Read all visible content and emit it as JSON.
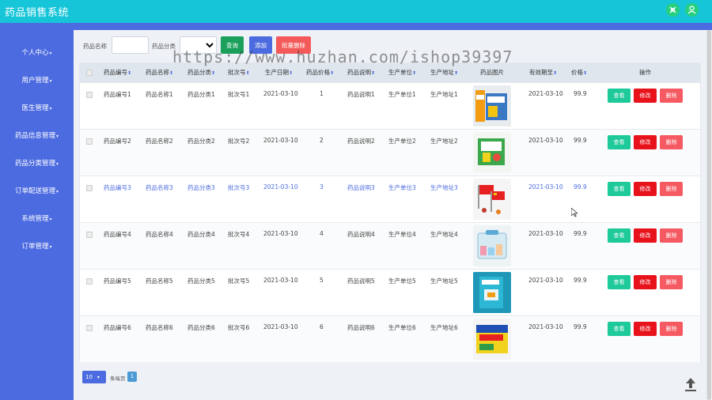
{
  "app": {
    "title": "药品销售系统",
    "colors": {
      "header": "#16c5d8",
      "sidebar": "#4c6be0",
      "search": "#1aa05b",
      "add": "#4c6be0",
      "batch_delete": "#f55a5a",
      "view": "#1ec99a",
      "edit": "#e8121b",
      "delete": "#f55a62"
    },
    "header_icons": [
      "expand-icon",
      "user-icon"
    ]
  },
  "sidebar": {
    "items": [
      {
        "label": "个人中心"
      },
      {
        "label": "用户管理"
      },
      {
        "label": "医生管理"
      },
      {
        "label": "药品信息管理"
      },
      {
        "label": "药品分类管理"
      },
      {
        "label": "订单配送管理"
      },
      {
        "label": "系统管理"
      },
      {
        "label": "订单管理"
      }
    ]
  },
  "filters": {
    "name_label": "药品名称",
    "name_value": "",
    "category_label": "药品分类",
    "category_value": "",
    "search_button": "查询",
    "add_button": "添加",
    "batch_delete_button": "批量删除"
  },
  "table": {
    "columns": [
      "药品编号",
      "药品名称",
      "药品分类",
      "批次号",
      "生产日期",
      "药品价格",
      "药品说明",
      "生产单位",
      "生产地址",
      "药品图片",
      "有效期至",
      "价格",
      "操作"
    ],
    "rows": [
      {
        "code": "药品编号1",
        "name": "药品名称1",
        "category": "药品分类1",
        "batch": "批次号1",
        "prod_date": "2021-03-10",
        "drug_price": "1",
        "desc": "药品说明1",
        "unit": "生产单位1",
        "address": "生产地址1",
        "image": "vitamin-box-image",
        "expiry": "2021-03-10",
        "price": "99.9"
      },
      {
        "code": "药品编号2",
        "name": "药品名称2",
        "category": "药品分类2",
        "batch": "批次号2",
        "prod_date": "2021-03-10",
        "drug_price": "2",
        "desc": "药品说明2",
        "unit": "生产单位2",
        "address": "生产地址2",
        "image": "green-medicine-box-image",
        "expiry": "2021-03-10",
        "price": "99.9"
      },
      {
        "code": "药品编号3",
        "name": "药品名称3",
        "category": "药品分类3",
        "batch": "批次号3",
        "prod_date": "2021-03-10",
        "drug_price": "3",
        "desc": "药品说明3",
        "unit": "生产单位3",
        "address": "生产地址3",
        "image": "pills-and-flags-image",
        "expiry": "2021-03-10",
        "price": "99.9"
      },
      {
        "code": "药品编号4",
        "name": "药品名称4",
        "category": "药品分类4",
        "batch": "批次号4",
        "prod_date": "2021-03-10",
        "drug_price": "4",
        "desc": "药品说明4",
        "unit": "生产单位4",
        "address": "生产地址4",
        "image": "first-aid-kit-image",
        "expiry": "2021-03-10",
        "price": "99.9"
      },
      {
        "code": "药品编号5",
        "name": "药品名称5",
        "category": "药品分类5",
        "batch": "批次号5",
        "prod_date": "2021-03-10",
        "drug_price": "5",
        "desc": "药品说明5",
        "unit": "生产单位5",
        "address": "生产地址5",
        "image": "teal-medicine-box-image",
        "expiry": "2021-03-10",
        "price": "99.9"
      },
      {
        "code": "药品编号6",
        "name": "药品名称6",
        "category": "药品分类6",
        "batch": "批次号6",
        "prod_date": "2021-03-10",
        "drug_price": "6",
        "desc": "药品说明6",
        "unit": "生产单位6",
        "address": "生产地址6",
        "image": "yellow-medicine-box-image",
        "expiry": "2021-03-10",
        "price": "99.9"
      }
    ],
    "actions": {
      "view": "查看",
      "edit": "修改",
      "delete": "删除"
    }
  },
  "pagination": {
    "page_size": "10",
    "page_size_label": "条每页",
    "current_page": "1"
  },
  "watermark": "https://www.huzhan.com/ishop39397"
}
